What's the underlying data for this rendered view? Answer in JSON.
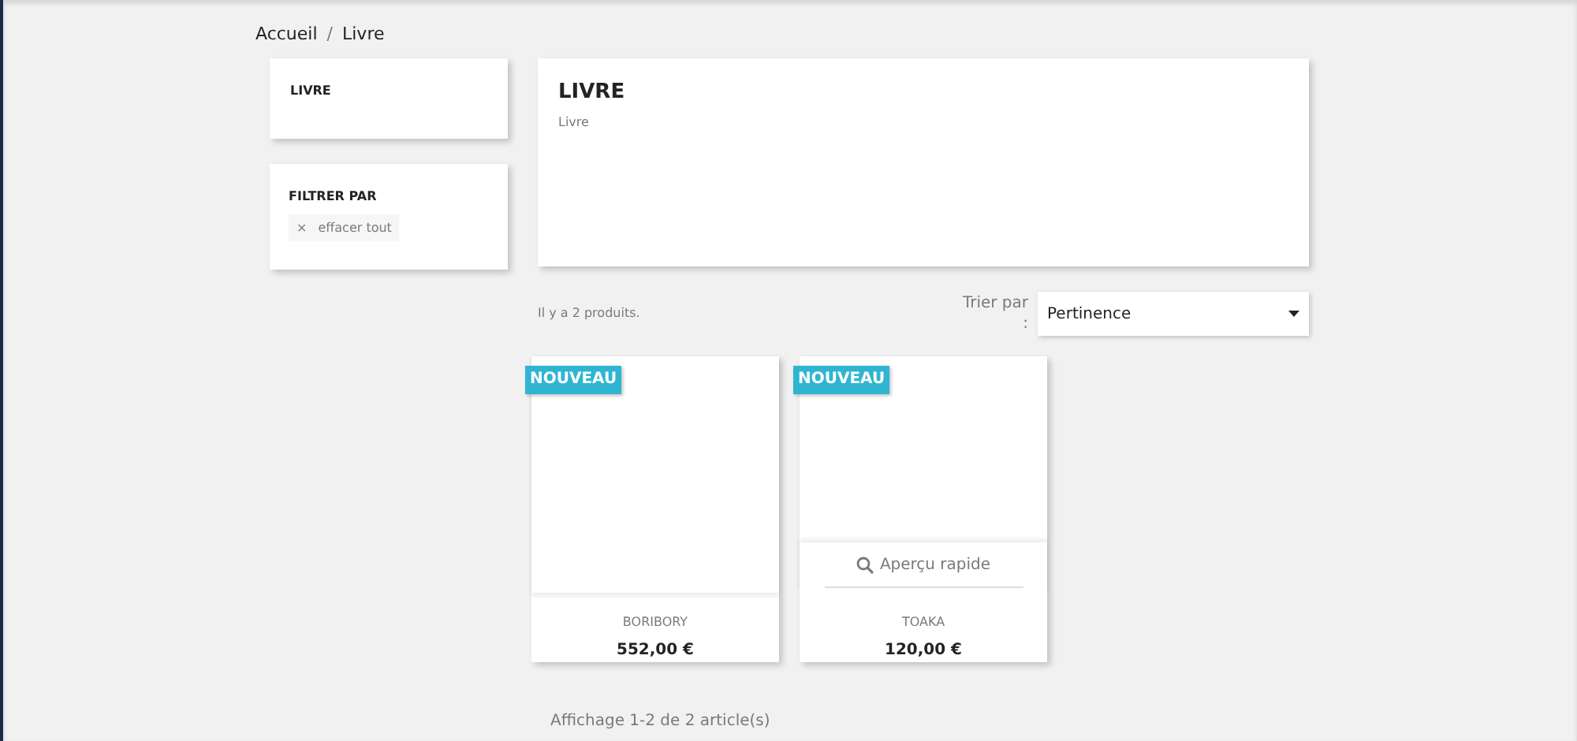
{
  "breadcrumb": [
    {
      "label": "Accueil"
    },
    {
      "label": "Livre"
    }
  ],
  "breadcrumb_separator": "/",
  "sidebar": {
    "category_title": "LIVRE",
    "filter_title": "FILTRER PAR",
    "clear_icon": "×",
    "clear_label": "effacer tout"
  },
  "category": {
    "title": "LIVRE",
    "description": "Livre"
  },
  "products_count": "Il y a 2 produits.",
  "sort": {
    "label": "Trier par :",
    "value": "Pertinence"
  },
  "products": [
    {
      "badge": "NOUVEAU",
      "name": "BORIBORY",
      "price": "552,00 €",
      "quick_view": false
    },
    {
      "badge": "NOUVEAU",
      "name": "TOAKA",
      "price": "120,00 €",
      "quick_view": true,
      "quick_view_label": "Aperçu rapide"
    }
  ],
  "pagination_summary": "Affichage 1-2 de 2 article(s)"
}
